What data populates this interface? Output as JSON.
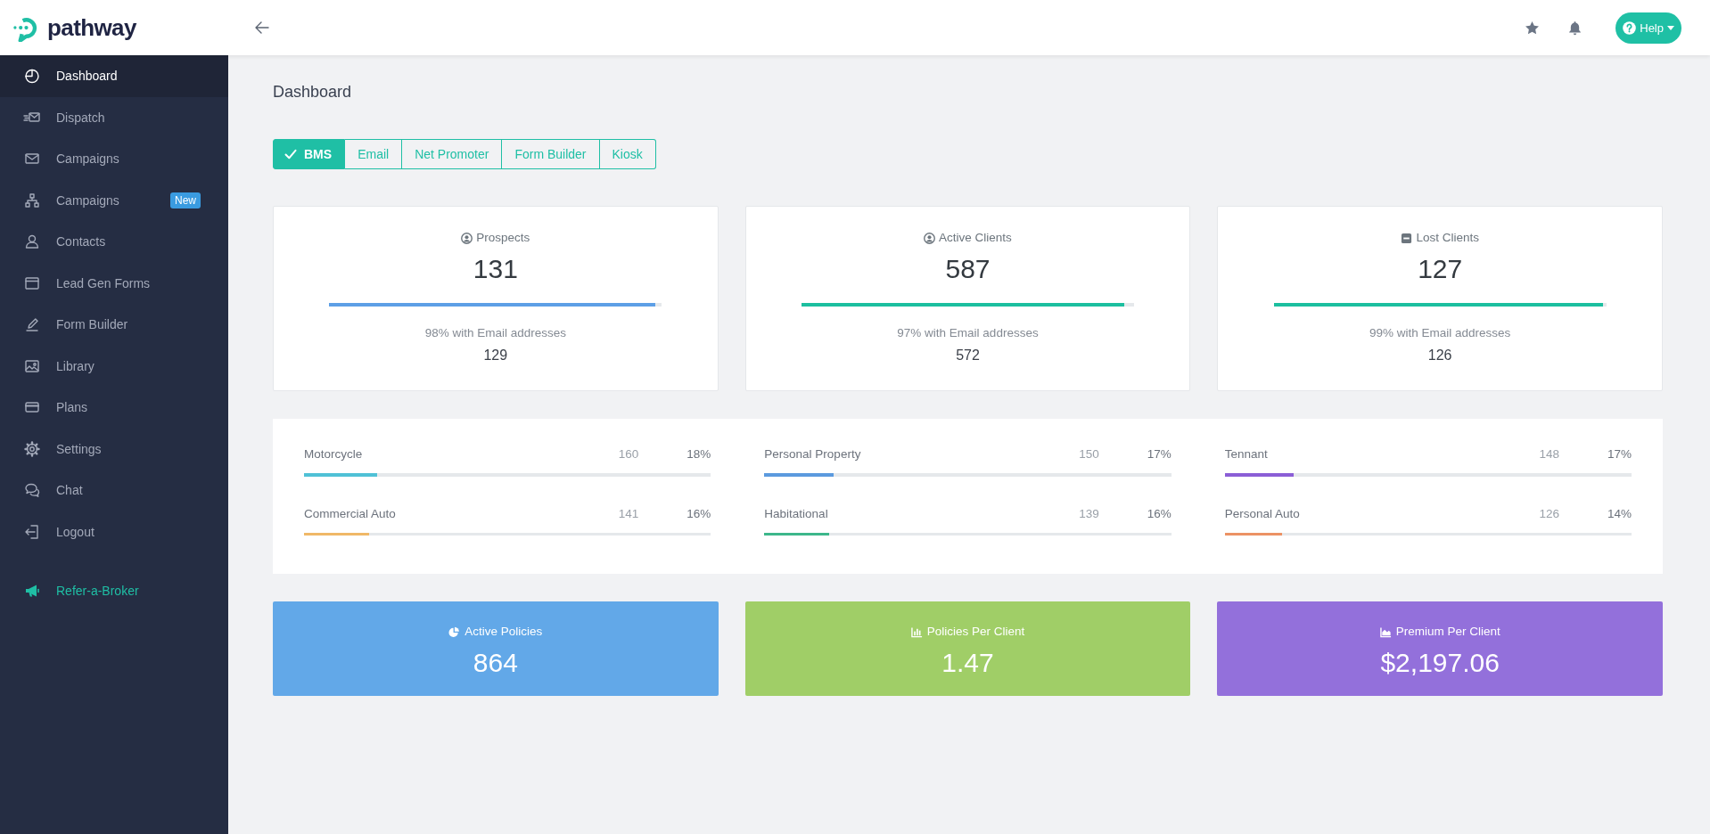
{
  "header": {
    "brand": "pathway",
    "help_button": {
      "label": "Help"
    }
  },
  "sidebar": {
    "items": [
      {
        "label": "Dashboard",
        "selected": true
      },
      {
        "label": "Dispatch",
        "selected": false
      },
      {
        "label": "Campaigns",
        "selected": false
      },
      {
        "label": "Campaigns",
        "selected": false,
        "badge": "New"
      },
      {
        "label": "Contacts",
        "selected": false
      },
      {
        "label": "Lead Gen Forms",
        "selected": false
      },
      {
        "label": "Form Builder",
        "selected": false
      },
      {
        "label": "Library",
        "selected": false
      },
      {
        "label": "Plans",
        "selected": false
      },
      {
        "label": "Settings",
        "selected": false
      },
      {
        "label": "Chat",
        "selected": false
      },
      {
        "label": "Logout",
        "selected": false
      }
    ],
    "promo_link": {
      "label": "Refer-a-Broker"
    }
  },
  "page_title": "Dashboard",
  "source_tabs": [
    {
      "label": "BMS",
      "selected": true
    },
    {
      "label": "Email",
      "selected": false
    },
    {
      "label": "Net Promoter",
      "selected": false
    },
    {
      "label": "Form Builder",
      "selected": false
    },
    {
      "label": "Kiosk",
      "selected": false
    }
  ],
  "summary_cards": [
    {
      "title": "Prospects",
      "value": "131",
      "level": 0.98,
      "color": "#5d9fe6",
      "note": "98% with Email addresses",
      "count": "129"
    },
    {
      "title": "Active Clients",
      "value": "587",
      "level": 0.97,
      "color": "#1cbf9f",
      "note": "97% with Email addresses",
      "count": "572"
    },
    {
      "title": "Lost Clients",
      "value": "127",
      "level": 0.99,
      "color": "#1cbf9f",
      "note": "99% with Email addresses",
      "count": "126"
    }
  ],
  "categories": [
    {
      "name": "Motorcycle",
      "count": "160",
      "percent": "18%",
      "level": 0.18,
      "color": "#4fc1d6"
    },
    {
      "name": "Personal Property",
      "count": "150",
      "percent": "17%",
      "level": 0.17,
      "color": "#5b9ade"
    },
    {
      "name": "Tennant",
      "count": "148",
      "percent": "17%",
      "level": 0.17,
      "color": "#8b5ed6"
    },
    {
      "name": "Commercial Auto",
      "count": "141",
      "percent": "16%",
      "level": 0.16,
      "color": "#f0b867"
    },
    {
      "name": "Habitational",
      "count": "139",
      "percent": "16%",
      "level": 0.16,
      "color": "#3db78b"
    },
    {
      "name": "Personal Auto",
      "count": "126",
      "percent": "14%",
      "level": 0.14,
      "color": "#ec9264"
    }
  ],
  "metric_cards": [
    {
      "title": "Active Policies",
      "value": "864",
      "color": "#62a8e8"
    },
    {
      "title": "Policies Per Client",
      "value": "1.47",
      "color": "#a0ce67"
    },
    {
      "title": "Premium Per Client",
      "value": "$2,197.06",
      "color": "#9370db"
    }
  ]
}
